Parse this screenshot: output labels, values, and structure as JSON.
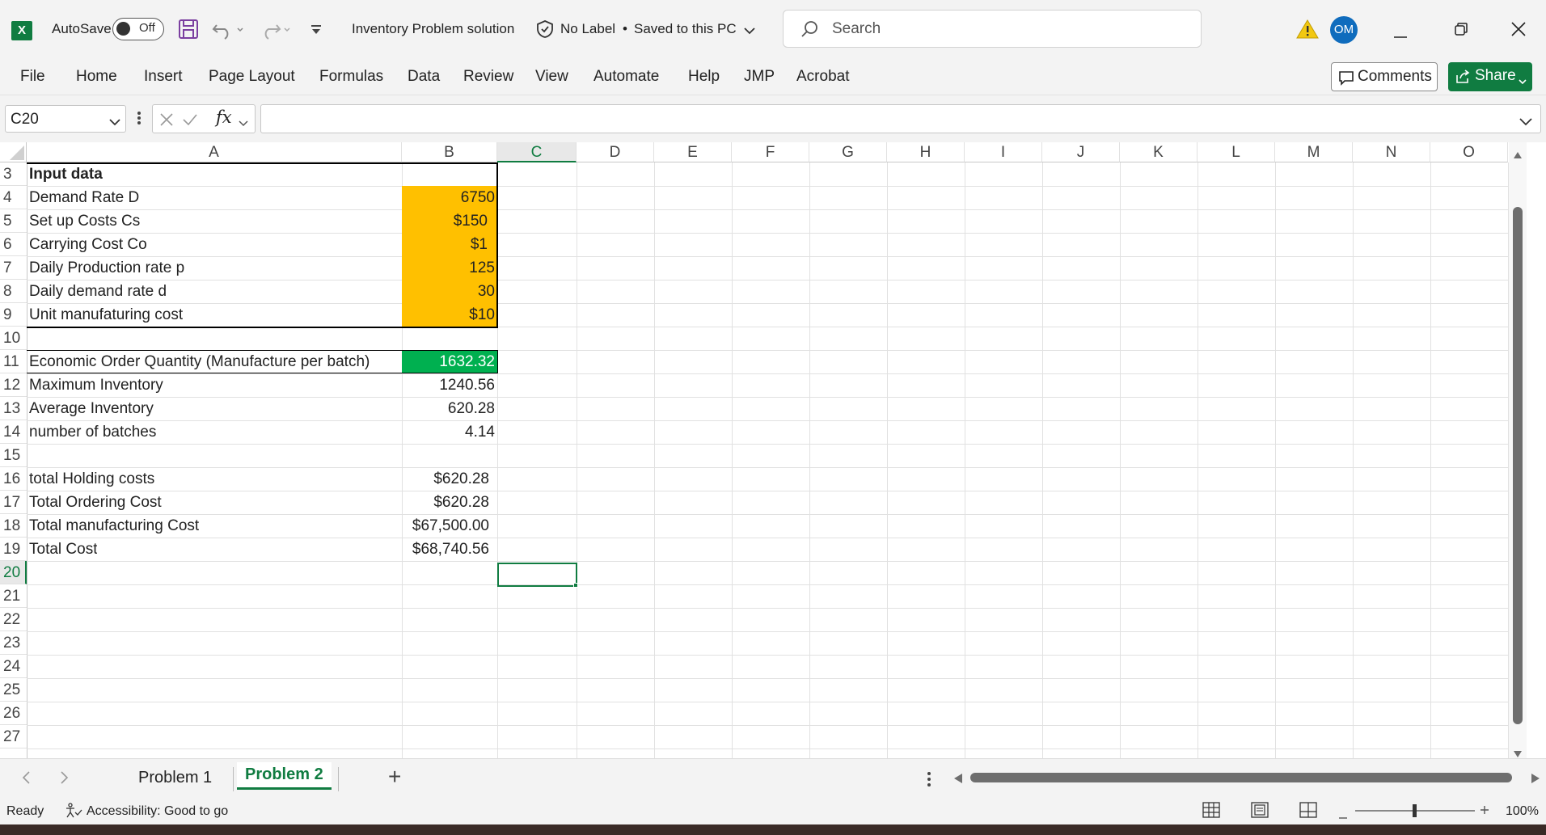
{
  "titlebar": {
    "app_icon": "X",
    "autosave_label": "AutoSave",
    "autosave_state": "Off",
    "doc_title": "Inventory Problem solution",
    "sensitivity": "No Label",
    "save_status": "Saved to this PC",
    "search_placeholder": "Search",
    "avatar_initials": "OM"
  },
  "ribbon": {
    "tabs": [
      "File",
      "Home",
      "Insert",
      "Page Layout",
      "Formulas",
      "Data",
      "Review",
      "View",
      "Automate",
      "Help",
      "JMP",
      "Acrobat"
    ],
    "comments_label": "Comments",
    "share_label": "Share"
  },
  "formula_bar": {
    "name_box": "C20",
    "fx_label": "fx",
    "formula": ""
  },
  "grid": {
    "columns": [
      "A",
      "B",
      "C",
      "D",
      "E",
      "F",
      "G",
      "H",
      "I",
      "J",
      "K",
      "L",
      "M",
      "N",
      "O"
    ],
    "selected_column": "C",
    "selected_row": "20",
    "rows": [
      {
        "row": "3",
        "a": "Input data",
        "b": ""
      },
      {
        "row": "4",
        "a": "Demand Rate D",
        "b": "6750"
      },
      {
        "row": "5",
        "a": "Set up Costs Cs",
        "b": "$150"
      },
      {
        "row": "6",
        "a": "Carrying Cost Co",
        "b": "$1"
      },
      {
        "row": "7",
        "a": "Daily Production rate p",
        "b": "125"
      },
      {
        "row": "8",
        "a": "Daily demand rate d",
        "b": "30"
      },
      {
        "row": "9",
        "a": "Unit manufaturing cost",
        "b": "$10"
      },
      {
        "row": "10",
        "a": "",
        "b": ""
      },
      {
        "row": "11",
        "a": "Economic Order Quantity (Manufacture per batch)",
        "b": "1632.32"
      },
      {
        "row": "12",
        "a": "Maximum Inventory",
        "b": "1240.56"
      },
      {
        "row": "13",
        "a": "Average Inventory",
        "b": "620.28"
      },
      {
        "row": "14",
        "a": "number of batches",
        "b": "4.14"
      },
      {
        "row": "15",
        "a": "",
        "b": ""
      },
      {
        "row": "16",
        "a": "total Holding costs",
        "b": "$620.28"
      },
      {
        "row": "17",
        "a": "Total Ordering Cost",
        "b": "$620.28"
      },
      {
        "row": "18",
        "a": "Total manufacturing  Cost",
        "b": "$67,500.00"
      },
      {
        "row": "19",
        "a": "Total Cost",
        "b": "$68,740.56"
      },
      {
        "row": "20",
        "a": "",
        "b": ""
      },
      {
        "row": "21",
        "a": "",
        "b": ""
      },
      {
        "row": "22",
        "a": "",
        "b": ""
      },
      {
        "row": "23",
        "a": "",
        "b": ""
      },
      {
        "row": "24",
        "a": "",
        "b": ""
      },
      {
        "row": "25",
        "a": "",
        "b": ""
      },
      {
        "row": "26",
        "a": "",
        "b": ""
      },
      {
        "row": "27",
        "a": "",
        "b": ""
      }
    ]
  },
  "sheets": {
    "tabs": [
      "Problem 1",
      "Problem 2"
    ],
    "active": "Problem 2",
    "add_label": "+"
  },
  "status": {
    "ready": "Ready",
    "accessibility": "Accessibility: Good to go",
    "zoom": "100%"
  },
  "colors": {
    "excel_green": "#107c41",
    "input_fill": "#ffc000",
    "eoq_fill": "#00b050",
    "avatar": "#0f6cbd"
  }
}
